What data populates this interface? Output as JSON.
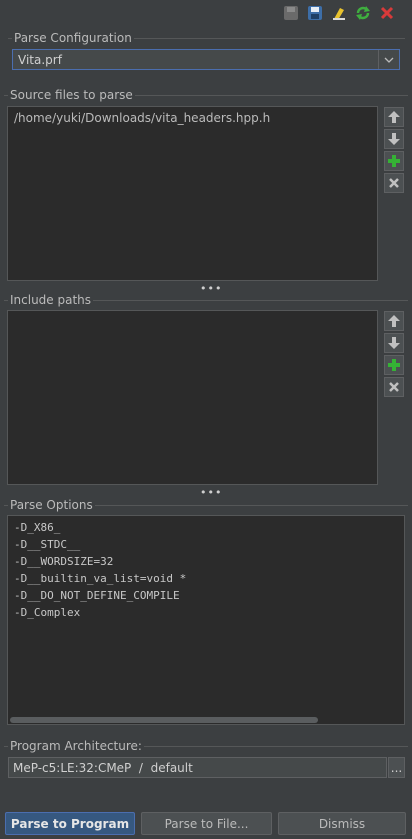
{
  "toolbar": {
    "icons": [
      "save-gray-icon",
      "save-as-icon",
      "clear-icon",
      "refresh-icon",
      "delete-icon"
    ]
  },
  "parse_config": {
    "title": "Parse Configuration",
    "selected": "Vita.prf"
  },
  "source_files": {
    "title": "Source files to parse",
    "items": [
      "/home/yuki/Downloads/vita_headers.hpp.h"
    ]
  },
  "include_paths": {
    "title": "Include paths"
  },
  "parse_options": {
    "title": "Parse Options",
    "lines": [
      "-D_X86_",
      "-D__STDC__",
      "-D__WORDSIZE=32",
      "-D__builtin_va_list=void *",
      "-D__DO_NOT_DEFINE_COMPILE",
      "-D_Complex"
    ]
  },
  "program_arch": {
    "title": "Program Architecture:",
    "value": "MeP-c5:LE:32:CMeP  /  default",
    "more": "..."
  },
  "splitter": "•••",
  "buttons": {
    "parse_program": "Parse to Program",
    "parse_file": "Parse to File...",
    "dismiss": "Dismiss"
  },
  "colors": {
    "accent": "#4b6eaf",
    "background": "#3c3f41",
    "panel": "#2b2b2b"
  }
}
